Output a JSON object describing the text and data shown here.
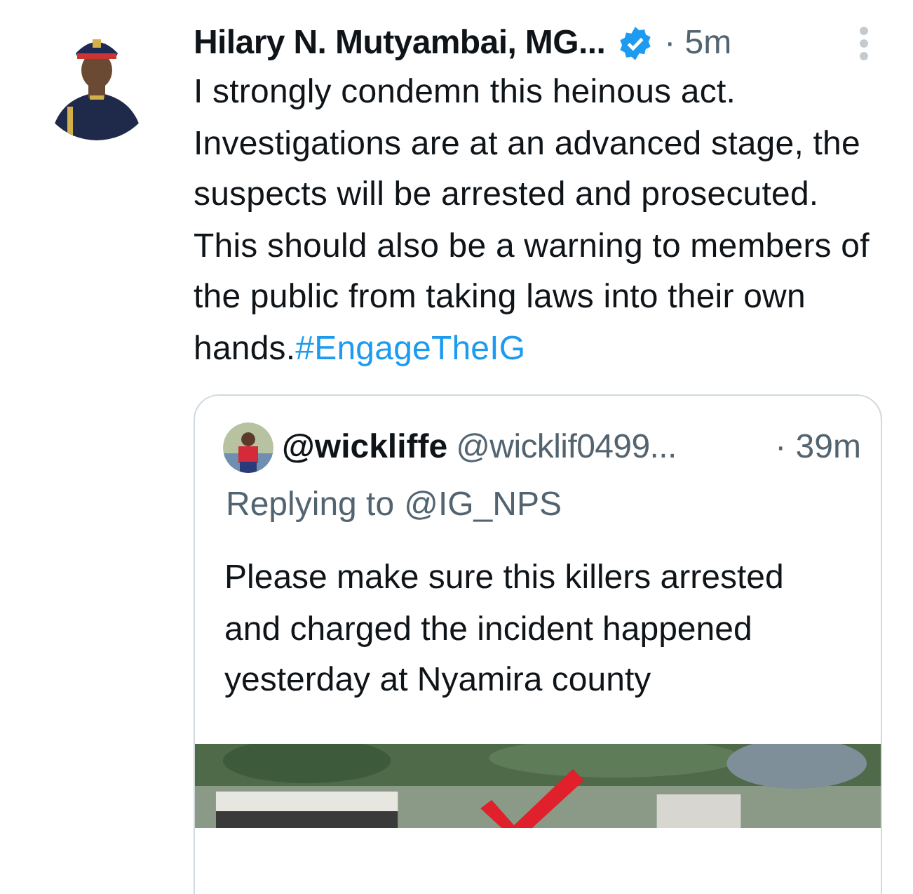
{
  "tweet": {
    "author": "Hilary N. Mutyambai, MG...",
    "verified": true,
    "time": "· 5m",
    "text": "I strongly condemn this heinous act. Investigations are at an advanced stage, the suspects will be arrested and prosecuted. This should also be a warning to members of the public from taking laws into their own hands.",
    "hashtag": "#EngageTheIG",
    "quoted": {
      "name": "@wickliffe",
      "handle": "@wicklif0499...",
      "time": "· 39m",
      "replying_label": "Replying to",
      "replying_to": "@IG_NPS",
      "text": "Please make sure this killers arrested and charged the incident happened yesterday at Nyamira county"
    }
  }
}
